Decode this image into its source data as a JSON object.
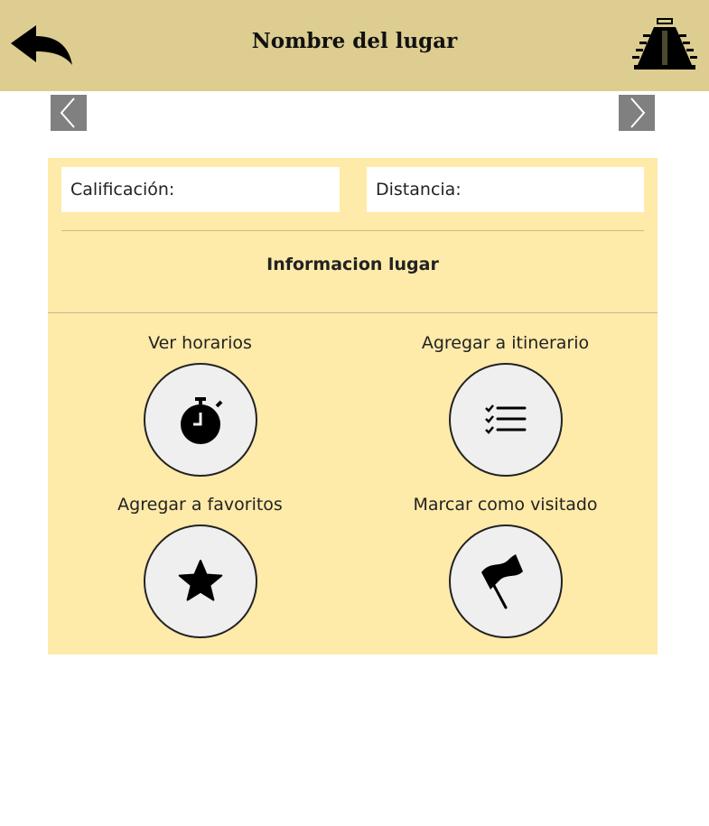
{
  "header": {
    "title": "Nombre del lugar",
    "back_icon": "back-arrow-icon",
    "logo_icon": "pyramid-logo-icon",
    "background": "#ddcd90"
  },
  "carousel": {
    "prev_icon": "chevron-left-icon",
    "next_icon": "chevron-right-icon"
  },
  "info": {
    "rating_label": "Calificación:",
    "distance_label": "Distancia:",
    "section_title": "Informacion lugar",
    "background": "#feeaa9"
  },
  "actions": [
    {
      "label": "Ver horarios",
      "icon": "stopwatch-icon"
    },
    {
      "label": "Agregar a itinerario",
      "icon": "checklist-icon"
    },
    {
      "label": "Agregar a favoritos",
      "icon": "star-icon"
    },
    {
      "label": "Marcar como visitado",
      "icon": "flag-icon"
    }
  ]
}
